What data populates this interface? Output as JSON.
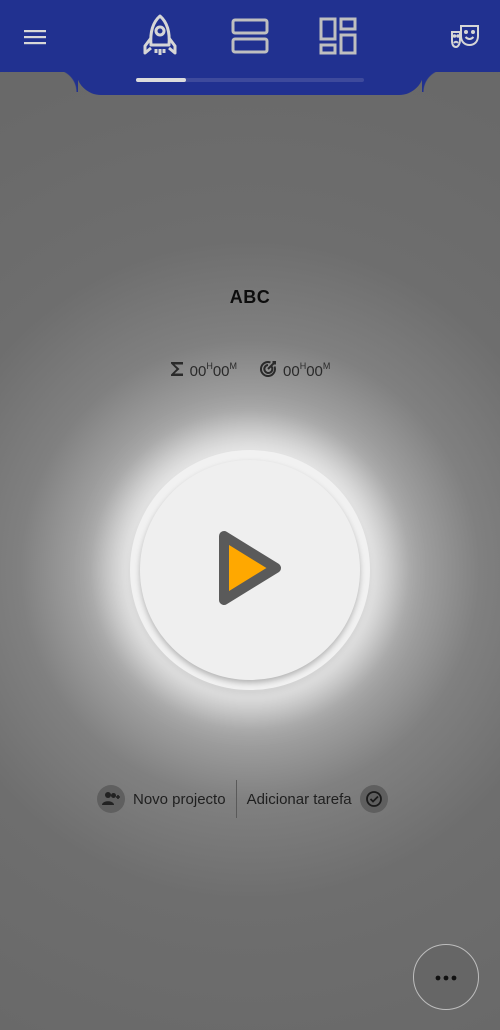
{
  "header": {
    "menu_icon": "hamburger-menu-icon",
    "tabs": [
      {
        "icon": "rocket-icon",
        "active": true
      },
      {
        "icon": "list-view-icon",
        "active": false
      },
      {
        "icon": "dashboard-icon",
        "active": false
      }
    ],
    "theme_icon": "theater-masks-icon"
  },
  "main": {
    "task_title": "ABC",
    "total_time": "00",
    "total_time_unit_h": "H",
    "total_time_min": "00",
    "total_time_unit_m": "M",
    "target_time": "00",
    "target_time_unit_h": "H",
    "target_time_min": "00",
    "target_time_unit_m": "M"
  },
  "actions": {
    "new_project_label": "Novo projecto",
    "add_task_label": "Adicionar tarefa"
  },
  "colors": {
    "header_bg": "#213190",
    "play_accent": "#FFA800",
    "play_outline": "#5a5a5a"
  }
}
